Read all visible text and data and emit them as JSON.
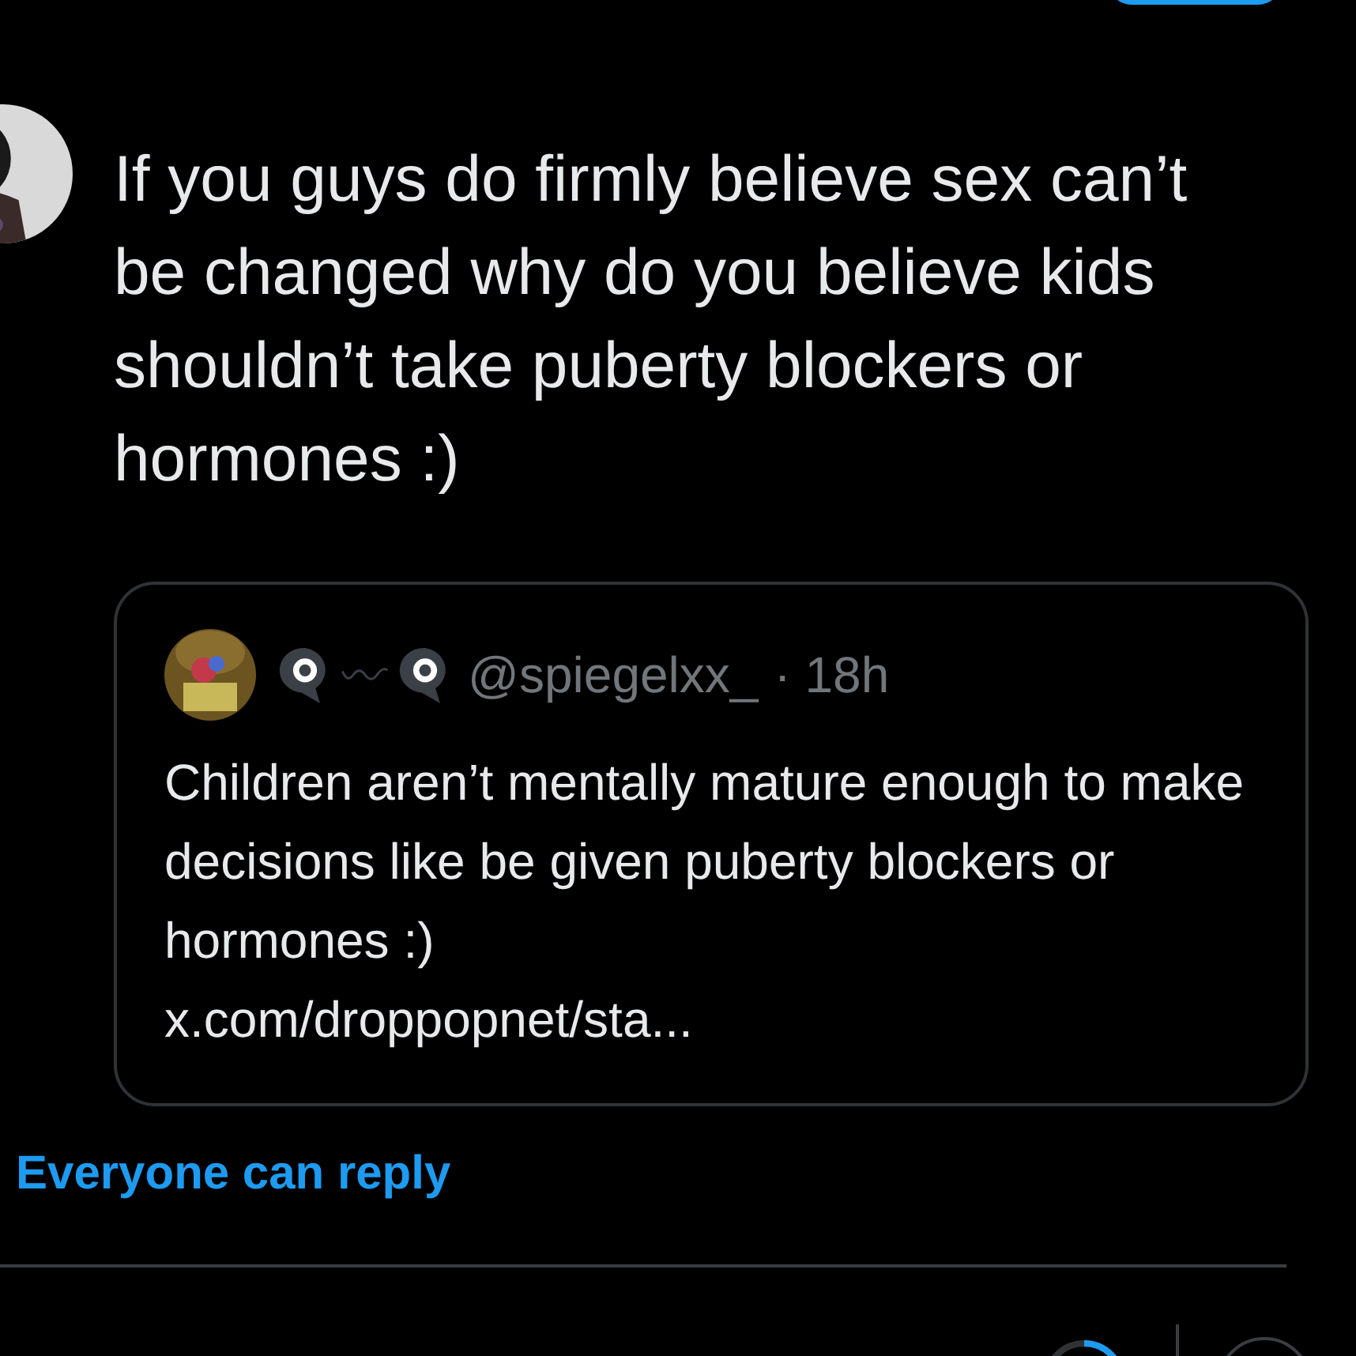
{
  "post": {
    "text": "If you guys do firmly believe sex can’t be changed why do you believe kids shouldn’t take puberty blockers or hormones :)"
  },
  "quote": {
    "handle": "@spiegelxx_",
    "time": "· 18h",
    "text": "Children aren’t mentally mature enough to make decisions like be given puberty blockers or hormones :)",
    "link": "x.com/droppopnet/sta..."
  },
  "reply_setting": "Everyone can reply"
}
